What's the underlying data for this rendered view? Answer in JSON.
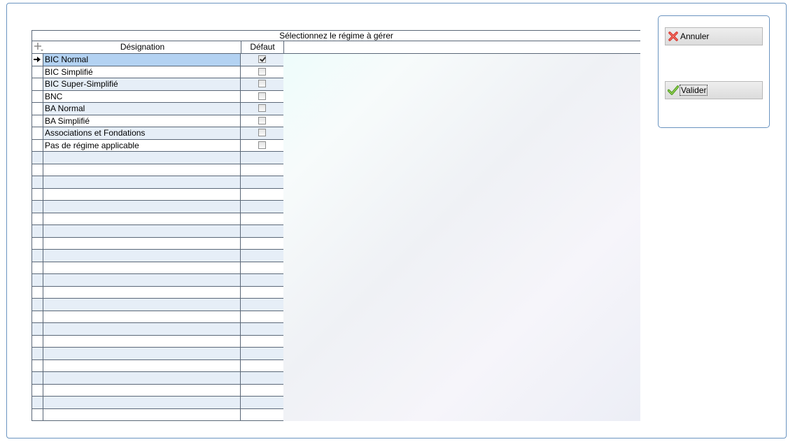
{
  "grid": {
    "caption": "Sélectionnez le régime à gérer",
    "columns": {
      "designation": "Désignation",
      "default": "Défaut"
    },
    "rows": [
      {
        "label": "BIC Normal",
        "default": true
      },
      {
        "label": "BIC Simplifié",
        "default": false
      },
      {
        "label": "BIC Super-Simplifié",
        "default": false
      },
      {
        "label": "BNC",
        "default": false
      },
      {
        "label": "BA Normal",
        "default": false
      },
      {
        "label": "BA Simplifié",
        "default": false
      },
      {
        "label": "Associations et Fondations",
        "default": false
      },
      {
        "label": "Pas de régime applicable",
        "default": false
      }
    ],
    "selected_index": 0
  },
  "actions": {
    "cancel_label": "Annuler",
    "ok_label": "Valider"
  },
  "icons": {
    "row_pointer": "arrow-right-icon",
    "column_chooser": "add-column-icon",
    "cancel": "red-x-icon",
    "ok": "green-check-icon"
  }
}
